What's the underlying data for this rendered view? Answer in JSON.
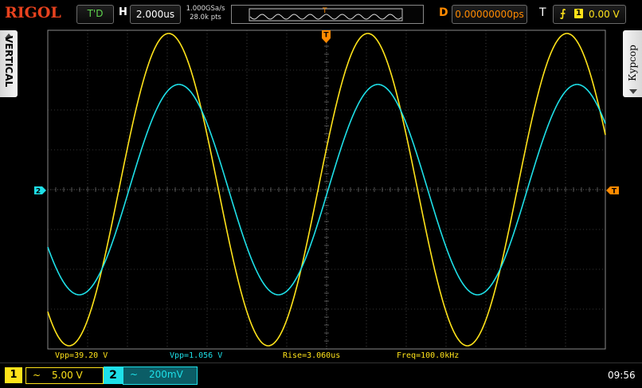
{
  "header": {
    "brand": "RIGOL",
    "run_status": "T'D",
    "timebase_label": "H",
    "timebase": "2.000us",
    "sample_rate": "1.000GSa/s",
    "memory_depth": "28.0k pts",
    "delay_label": "D",
    "delay": "0.00000000ps",
    "trigger_label": "T",
    "trigger_edge_icon": "rising-edge-icon",
    "trigger_source": "1",
    "trigger_level": "0.00 V"
  },
  "side_menus": {
    "left": "VERTICAL",
    "right": "Курсор"
  },
  "markers": {
    "ch2_ref": "2",
    "trigger_top": "T",
    "trigger_right": "T"
  },
  "colors": {
    "ch1": "#ffe31a",
    "ch2": "#1ee0e8",
    "trigger": "#ff8a00",
    "grid": "#6a6a6a"
  },
  "chart_data": {
    "type": "line",
    "grid": true,
    "x_divisions": 14,
    "y_divisions": 8,
    "series": [
      {
        "name": "1",
        "frequency_hz": 100000,
        "vpp_v": 39.2,
        "vertical_scale": "5.00 V"
      },
      {
        "name": "2",
        "frequency_hz": 100000,
        "vpp_v": 1.056,
        "vertical_scale": "200mV"
      }
    ]
  },
  "measurements": {
    "ch1_vpp": "Vpp=39.20 V",
    "ch2_vpp": "Vpp=1.056 V",
    "rise": "Rise=3.060us",
    "freq": "Freq=100.0kHz"
  },
  "footer": {
    "ch1_label": "1",
    "ch1_coupling": "~",
    "ch1_scale": "5.00 V",
    "ch2_label": "2",
    "ch2_coupling": "~",
    "ch2_scale": "200mV",
    "clock": "09:56"
  }
}
